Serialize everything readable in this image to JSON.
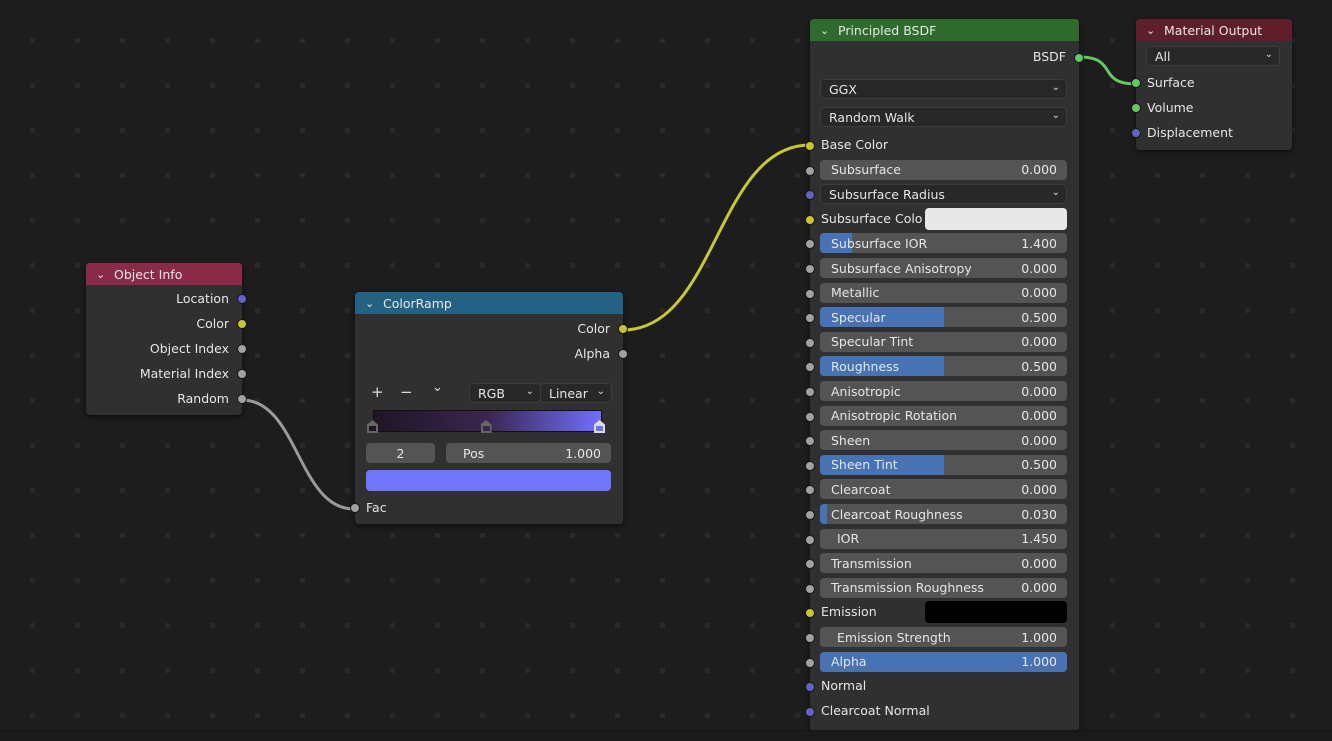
{
  "colors": {
    "canvas_bg": "#1d1d1d",
    "grid_dot": "#2a2a2a",
    "node_bg": "#303030",
    "header_object_info": "#8a2a48",
    "header_colorramp": "#246283",
    "header_principled": "#2e6b2c",
    "header_material_output": "#5e1f2b",
    "socket_vector": "#6363c7",
    "socket_color": "#c7c729",
    "socket_float": "#a1a1a1",
    "socket_shader": "#63c763",
    "slider_fill": "#4772b3",
    "link_color": "#c9c92a",
    "link_float": "#9a9a9a",
    "link_shader": "#63c763"
  },
  "object_info": {
    "title": "Object Info",
    "outputs": [
      {
        "label": "Location",
        "type": "vector"
      },
      {
        "label": "Color",
        "type": "color"
      },
      {
        "label": "Object Index",
        "type": "float"
      },
      {
        "label": "Material Index",
        "type": "float"
      },
      {
        "label": "Random",
        "type": "float"
      }
    ]
  },
  "colorramp": {
    "title": "ColorRamp",
    "outputs": [
      {
        "label": "Color",
        "type": "color"
      },
      {
        "label": "Alpha",
        "type": "float"
      }
    ],
    "add_icon": "+",
    "remove_icon": "−",
    "menu_icon": "⌄",
    "color_mode": "RGB",
    "interpolation": "Linear",
    "active_index": "2",
    "pos_label": "Pos",
    "pos_value": "1.000",
    "stops": [
      {
        "position": 0.0,
        "color": "#1e1525"
      },
      {
        "position": 0.5,
        "color": "#3a2650"
      },
      {
        "position": 1.0,
        "color": "#7070ff"
      }
    ],
    "active_color": "#7075fa",
    "input": {
      "label": "Fac",
      "type": "float"
    }
  },
  "principled": {
    "title": "Principled BSDF",
    "output": {
      "label": "BSDF",
      "type": "shader"
    },
    "distribution": "GGX",
    "subsurface_method": "Random Walk",
    "inputs": [
      {
        "kind": "socket",
        "label": "Base Color",
        "type": "color"
      },
      {
        "kind": "slider",
        "label": "Subsurface",
        "value": "0.000",
        "fill": 0.0,
        "type": "float"
      },
      {
        "kind": "dropdown",
        "label": "Subsurface Radius",
        "type": "vector"
      },
      {
        "kind": "color",
        "label": "Subsurface Colo",
        "swatch": "#e8e8e8",
        "type": "color"
      },
      {
        "kind": "slider",
        "label": "Subsurface IOR",
        "value": "1.400",
        "fill": 0.13,
        "type": "float"
      },
      {
        "kind": "slider",
        "label": "Subsurface Anisotropy",
        "value": "0.000",
        "fill": 0.0,
        "type": "float"
      },
      {
        "kind": "slider",
        "label": "Metallic",
        "value": "0.000",
        "fill": 0.0,
        "type": "float"
      },
      {
        "kind": "slider",
        "label": "Specular",
        "value": "0.500",
        "fill": 0.5,
        "type": "float"
      },
      {
        "kind": "slider",
        "label": "Specular Tint",
        "value": "0.000",
        "fill": 0.0,
        "type": "float"
      },
      {
        "kind": "slider",
        "label": "Roughness",
        "value": "0.500",
        "fill": 0.5,
        "type": "float"
      },
      {
        "kind": "slider",
        "label": "Anisotropic",
        "value": "0.000",
        "fill": 0.0,
        "type": "float"
      },
      {
        "kind": "slider",
        "label": "Anisotropic Rotation",
        "value": "0.000",
        "fill": 0.0,
        "type": "float"
      },
      {
        "kind": "slider",
        "label": "Sheen",
        "value": "0.000",
        "fill": 0.0,
        "type": "float"
      },
      {
        "kind": "slider",
        "label": "Sheen Tint",
        "value": "0.500",
        "fill": 0.5,
        "type": "float"
      },
      {
        "kind": "slider",
        "label": "Clearcoat",
        "value": "0.000",
        "fill": 0.0,
        "type": "float"
      },
      {
        "kind": "slider",
        "label": "Clearcoat Roughness",
        "value": "0.030",
        "fill": 0.03,
        "type": "float"
      },
      {
        "kind": "number",
        "label": "IOR",
        "value": "1.450",
        "type": "float"
      },
      {
        "kind": "slider",
        "label": "Transmission",
        "value": "0.000",
        "fill": 0.0,
        "type": "float"
      },
      {
        "kind": "slider",
        "label": "Transmission Roughness",
        "value": "0.000",
        "fill": 0.0,
        "type": "float"
      },
      {
        "kind": "color",
        "label": "Emission",
        "swatch": "#000000",
        "type": "color"
      },
      {
        "kind": "number",
        "label": "Emission Strength",
        "value": "1.000",
        "type": "float"
      },
      {
        "kind": "slider",
        "label": "Alpha",
        "value": "1.000",
        "fill": 1.0,
        "type": "float"
      },
      {
        "kind": "socket",
        "label": "Normal",
        "type": "vector"
      },
      {
        "kind": "socket",
        "label": "Clearcoat Normal",
        "type": "vector"
      }
    ]
  },
  "material_output": {
    "title": "Material Output",
    "target": "All",
    "inputs": [
      {
        "label": "Surface",
        "type": "shader"
      },
      {
        "label": "Volume",
        "type": "shader"
      },
      {
        "label": "Displacement",
        "type": "vector"
      }
    ]
  }
}
